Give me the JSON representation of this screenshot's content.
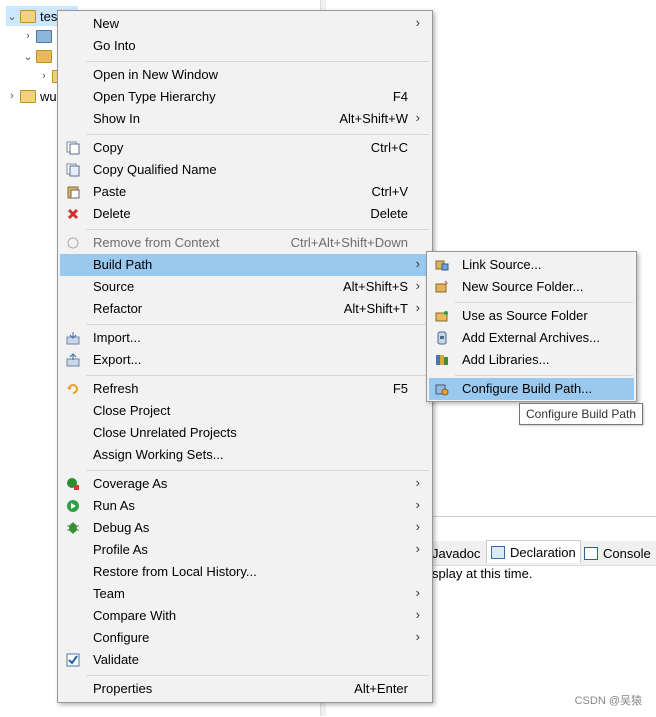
{
  "explorer": {
    "items": [
      {
        "label": "tes",
        "expanded": true
      },
      {
        "label": "",
        "expanded": false
      },
      {
        "label": "",
        "expanded": true
      },
      {
        "label": "",
        "expanded": false
      },
      {
        "label": "wu",
        "expanded": false
      }
    ]
  },
  "bottom_panel": {
    "tabs": [
      "Javadoc",
      "Declaration",
      "Console"
    ],
    "message": "splay at this time."
  },
  "context_menu": {
    "items": [
      {
        "label": "New",
        "shortcut": "",
        "submenu": true
      },
      {
        "label": "Go Into",
        "shortcut": ""
      },
      {
        "label": "Open in New Window",
        "shortcut": ""
      },
      {
        "label": "Open Type Hierarchy",
        "shortcut": "F4"
      },
      {
        "label": "Show In",
        "shortcut": "Alt+Shift+W",
        "submenu": true
      },
      {
        "label": "Copy",
        "shortcut": "Ctrl+C",
        "icon": "copy-icon"
      },
      {
        "label": "Copy Qualified Name",
        "shortcut": "",
        "icon": "copy-qualified-icon"
      },
      {
        "label": "Paste",
        "shortcut": "Ctrl+V",
        "icon": "paste-icon"
      },
      {
        "label": "Delete",
        "shortcut": "Delete",
        "icon": "delete-icon"
      },
      {
        "label": "Remove from Context",
        "shortcut": "Ctrl+Alt+Shift+Down",
        "disabled": true,
        "icon": "remove-context-icon"
      },
      {
        "label": "Build Path",
        "shortcut": "",
        "submenu": true,
        "selected": true
      },
      {
        "label": "Source",
        "shortcut": "Alt+Shift+S",
        "submenu": true
      },
      {
        "label": "Refactor",
        "shortcut": "Alt+Shift+T",
        "submenu": true
      },
      {
        "label": "Import...",
        "shortcut": "",
        "icon": "import-icon"
      },
      {
        "label": "Export...",
        "shortcut": "",
        "icon": "export-icon"
      },
      {
        "label": "Refresh",
        "shortcut": "F5",
        "icon": "refresh-icon"
      },
      {
        "label": "Close Project",
        "shortcut": ""
      },
      {
        "label": "Close Unrelated Projects",
        "shortcut": ""
      },
      {
        "label": "Assign Working Sets...",
        "shortcut": ""
      },
      {
        "label": "Coverage As",
        "shortcut": "",
        "submenu": true,
        "icon": "coverage-icon"
      },
      {
        "label": "Run As",
        "shortcut": "",
        "submenu": true,
        "icon": "run-icon"
      },
      {
        "label": "Debug As",
        "shortcut": "",
        "submenu": true,
        "icon": "debug-icon"
      },
      {
        "label": "Profile As",
        "shortcut": "",
        "submenu": true
      },
      {
        "label": "Restore from Local History...",
        "shortcut": ""
      },
      {
        "label": "Team",
        "shortcut": "",
        "submenu": true
      },
      {
        "label": "Compare With",
        "shortcut": "",
        "submenu": true
      },
      {
        "label": "Configure",
        "shortcut": "",
        "submenu": true
      },
      {
        "label": "Validate",
        "shortcut": "",
        "icon": "validate-checkbox-icon"
      },
      {
        "label": "Properties",
        "shortcut": "Alt+Enter"
      }
    ]
  },
  "build_path_submenu": {
    "items": [
      {
        "label": "Link Source...",
        "icon": "link-source-icon"
      },
      {
        "label": "New Source Folder...",
        "icon": "new-source-folder-icon"
      },
      {
        "label": "Use as Source Folder",
        "icon": "use-source-folder-icon"
      },
      {
        "label": "Add External Archives...",
        "icon": "add-archives-icon"
      },
      {
        "label": "Add Libraries...",
        "icon": "add-libraries-icon"
      },
      {
        "label": "Configure Build Path...",
        "icon": "configure-build-path-icon",
        "selected": true
      }
    ]
  },
  "tooltip": "Configure Build Path",
  "watermark": "CSDN @吴猿",
  "colors": {
    "selection": "#99c9ef",
    "menu_bg": "#f2f2f2",
    "separator": "#d7d7d7"
  }
}
